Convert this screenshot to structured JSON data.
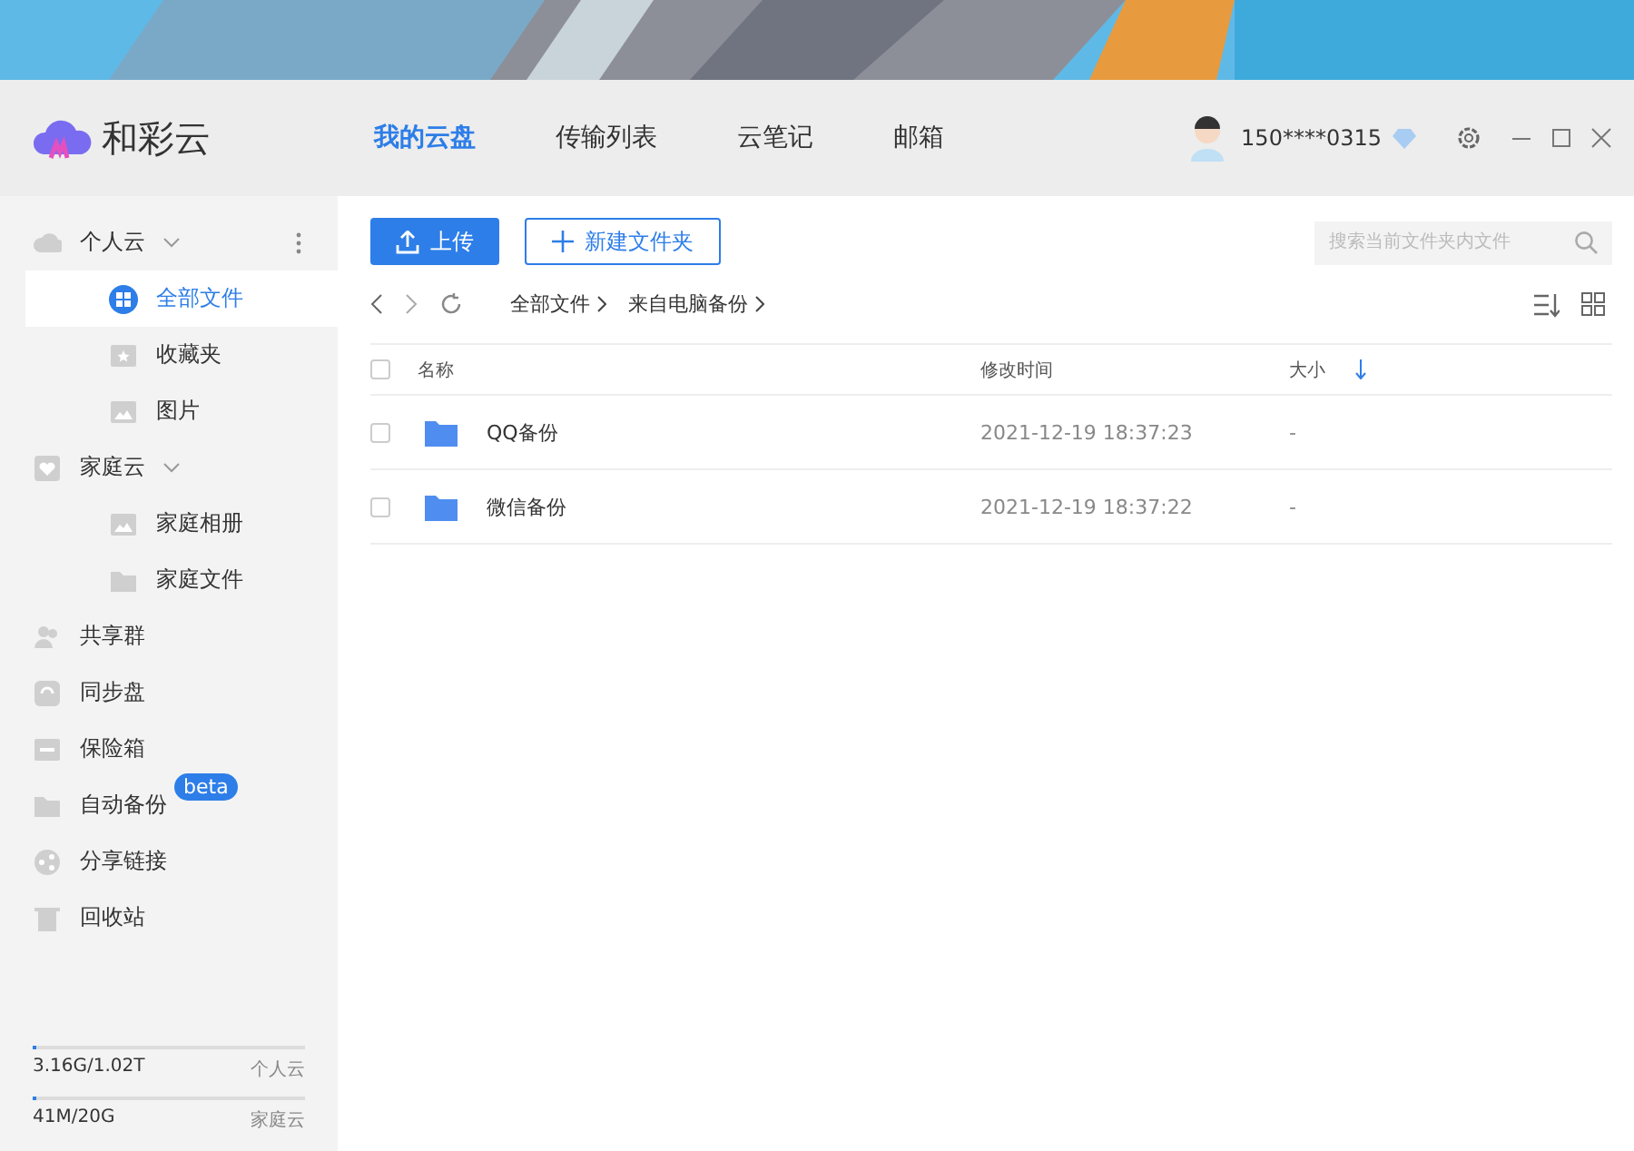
{
  "app": {
    "name": "和彩云"
  },
  "nav_tabs": [
    {
      "label": "我的云盘",
      "selected": true
    },
    {
      "label": "传输列表",
      "selected": false
    },
    {
      "label": "云笔记",
      "selected": false
    },
    {
      "label": "邮箱",
      "selected": false
    }
  ],
  "user": {
    "phone": "150****0315"
  },
  "sidebar": {
    "items": [
      {
        "label": "个人云",
        "expanded": true,
        "children": [
          {
            "label": "全部文件",
            "selected": true
          },
          {
            "label": "收藏夹",
            "selected": false
          },
          {
            "label": "图片",
            "selected": false
          }
        ]
      },
      {
        "label": "家庭云",
        "expanded": true,
        "children": [
          {
            "label": "家庭相册",
            "selected": false
          },
          {
            "label": "家庭文件",
            "selected": false
          }
        ]
      },
      {
        "label": "共享群"
      },
      {
        "label": "同步盘"
      },
      {
        "label": "保险箱"
      },
      {
        "label": "自动备份",
        "badge": "beta"
      },
      {
        "label": "分享链接"
      },
      {
        "label": "回收站"
      }
    ]
  },
  "storage": [
    {
      "usage": "3.16G/1.02T",
      "name": "个人云",
      "level": 0.01
    },
    {
      "usage": "41M/20G",
      "name": "家庭云",
      "level": 0.01
    }
  ],
  "toolbar": {
    "upload": "上传",
    "new_folder": "新建文件夹",
    "search": {
      "placeholder": "搜索当前文件夹内文件"
    }
  },
  "breadcrumb": [
    "全部文件",
    "来自电脑备份"
  ],
  "table": {
    "columns": [
      "名称",
      "修改时间",
      "大小"
    ],
    "all_checked": false,
    "rows": [
      {
        "name": "QQ备份",
        "modified": "2021-12-19 18:37:23",
        "size": "-",
        "checked": false
      },
      {
        "name": "微信备份",
        "modified": "2021-12-19 18:37:22",
        "size": "-",
        "checked": false
      }
    ]
  }
}
